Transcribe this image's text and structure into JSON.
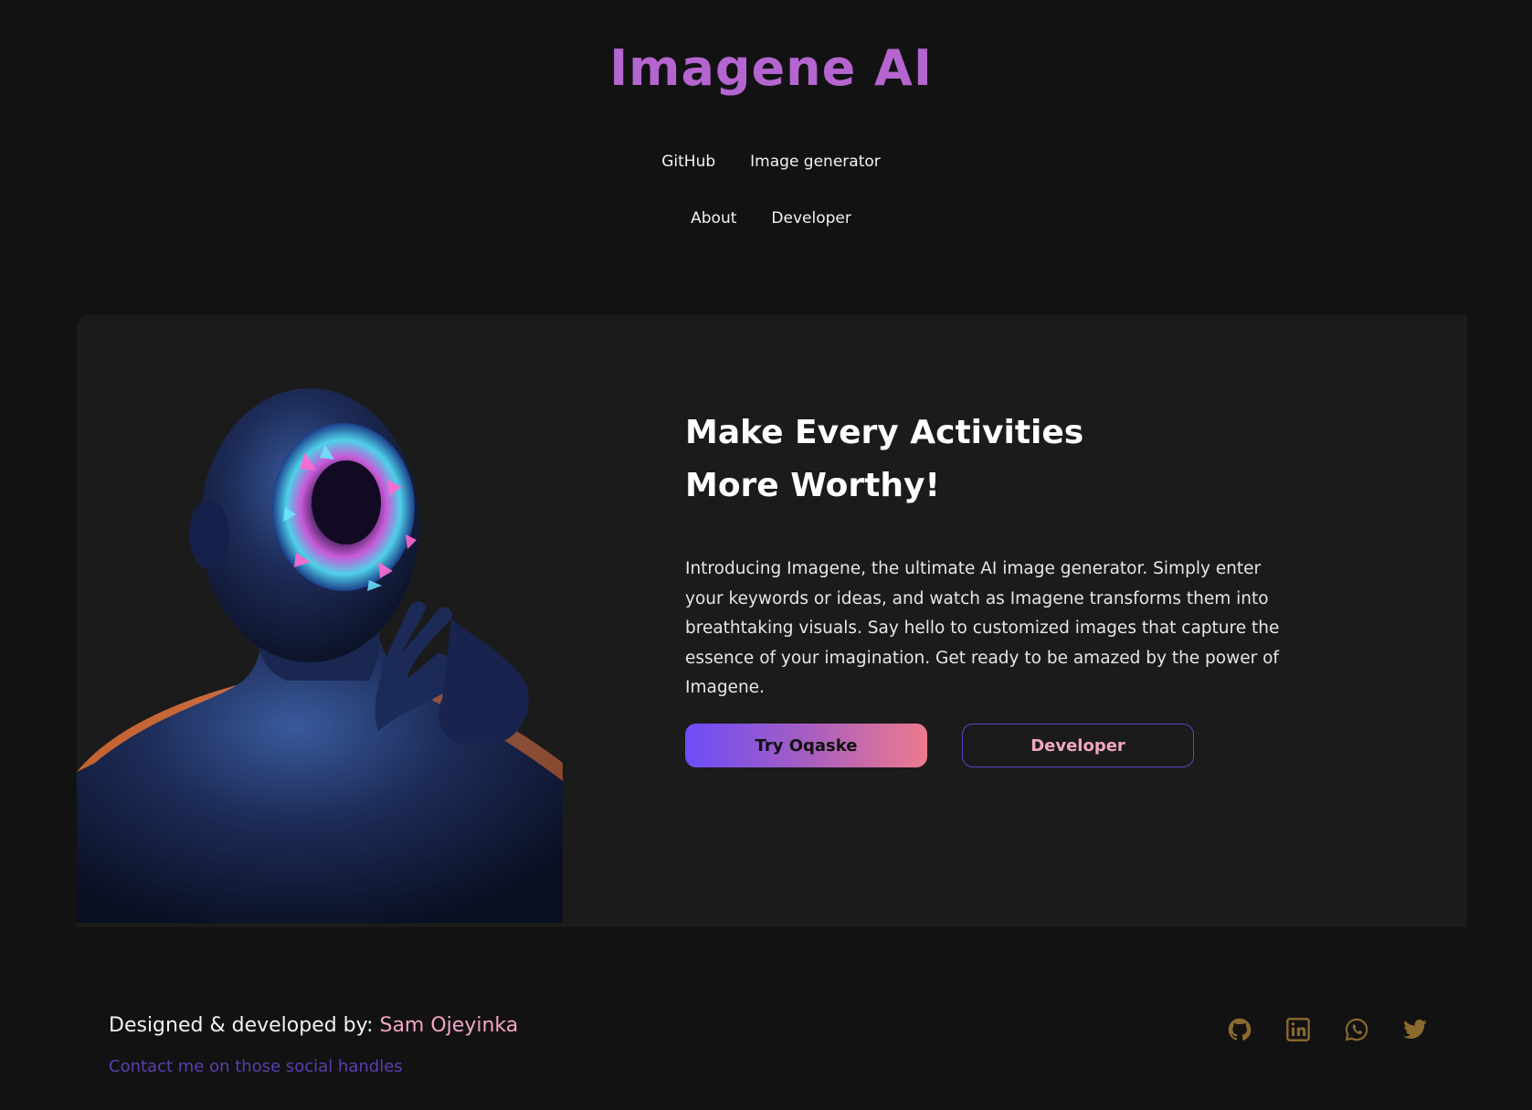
{
  "brand": {
    "name": "Imagene AI",
    "accent": "#b465cf"
  },
  "nav": {
    "row1": [
      "GitHub",
      "Image generator"
    ],
    "row2": [
      "About",
      "Developer"
    ]
  },
  "hero": {
    "title": "Make Every Activities More Worthy!",
    "description": "Introducing Imagene, the ultimate AI image generator. Simply enter your keywords or ideas, and watch as Imagene transforms them into breathtaking visuals. Say hello to customized images that capture the essence of your imagination. Get ready to be amazed by the power of Imagene.",
    "primary_button": "Try Oqaske",
    "secondary_button": "Developer",
    "image_icon": "figure-illustration"
  },
  "footer": {
    "credit_prefix": "Designed & developed by:",
    "credit_author": "Sam Ojeyinka",
    "contact": "Contact me on those social handles",
    "social_icons": [
      "github-icon",
      "linkedin-icon",
      "whatsapp-icon",
      "twitter-icon"
    ],
    "social_color": "#8c6a2e"
  },
  "colors": {
    "background": "#121212",
    "card": "#1b1b1b",
    "gradient_start": "#6c4df7",
    "gradient_end": "#ee7a8e",
    "author": "#f4a6c6",
    "contact": "#5a3fb0"
  }
}
